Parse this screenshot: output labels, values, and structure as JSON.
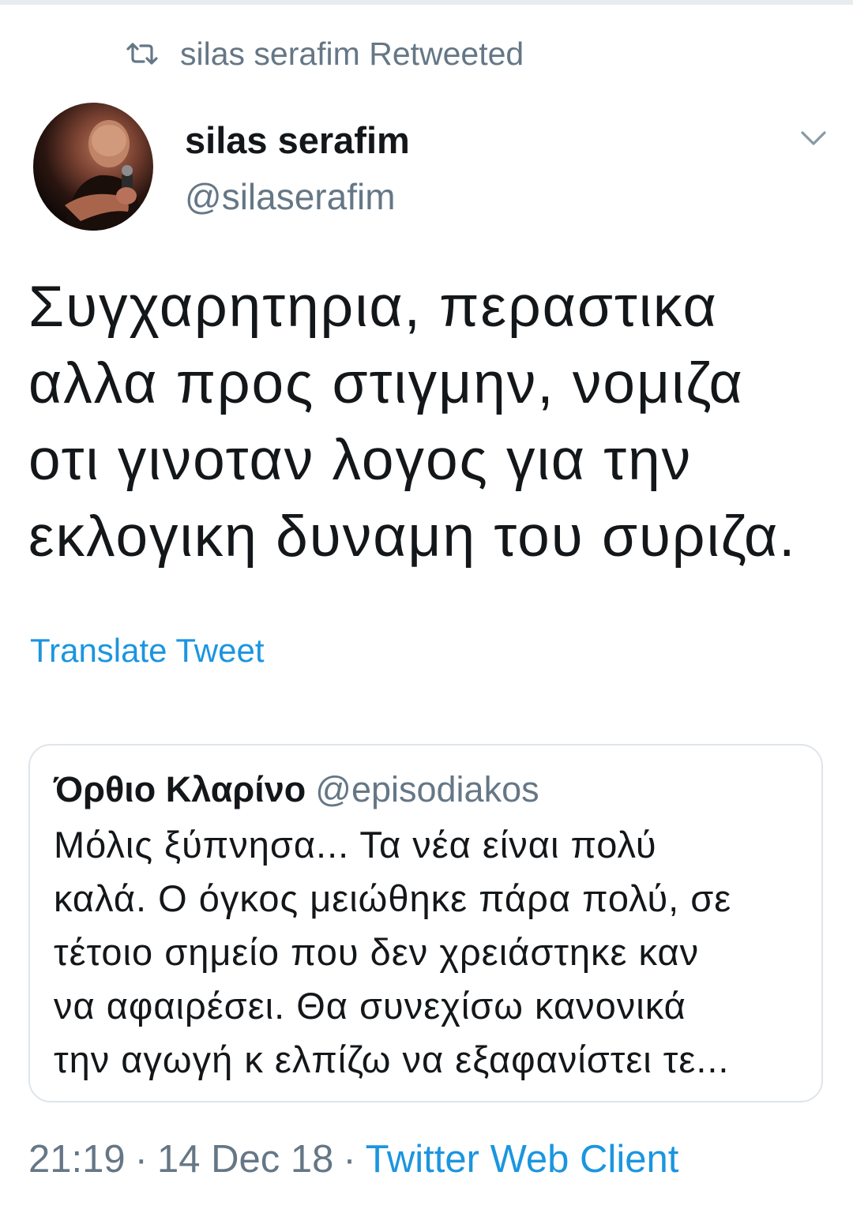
{
  "retweet": {
    "icon": "retweet-icon",
    "label": "silas serafim Retweeted"
  },
  "author": {
    "name": "silas serafim",
    "handle": "@silaserafim"
  },
  "tweet": {
    "lines": [
      "Συγχαρητηρια, περαστικα",
      "αλλα προς στιγμην, νομιζα",
      "οτι γινοταν λογος για την",
      "εκλογικη δυναμη του συριζα."
    ],
    "translate_label": "Translate Tweet"
  },
  "quoted": {
    "name": "Όρθιο Κλαρίνο",
    "handle": "@episodiakos",
    "lines": [
      "Μόλις ξύπνησα... Τα νέα είναι πολύ",
      "καλά. Ο όγκος μειώθηκε πάρα πολύ, σε",
      "τέτοιο σημείο που δεν χρειάστηκε καν",
      "να αφαιρέσει. Θα συνεχίσω κανονικά",
      "την αγωγή κ ελπίζω να εξαφανίστει τε..."
    ]
  },
  "meta": {
    "time": "21:19",
    "date": "14 Dec 18",
    "separator": "·",
    "client": "Twitter Web Client"
  },
  "colors": {
    "text": "#14171a",
    "secondary": "#657786",
    "link": "#1b95e0",
    "border": "#dfe5ea"
  }
}
